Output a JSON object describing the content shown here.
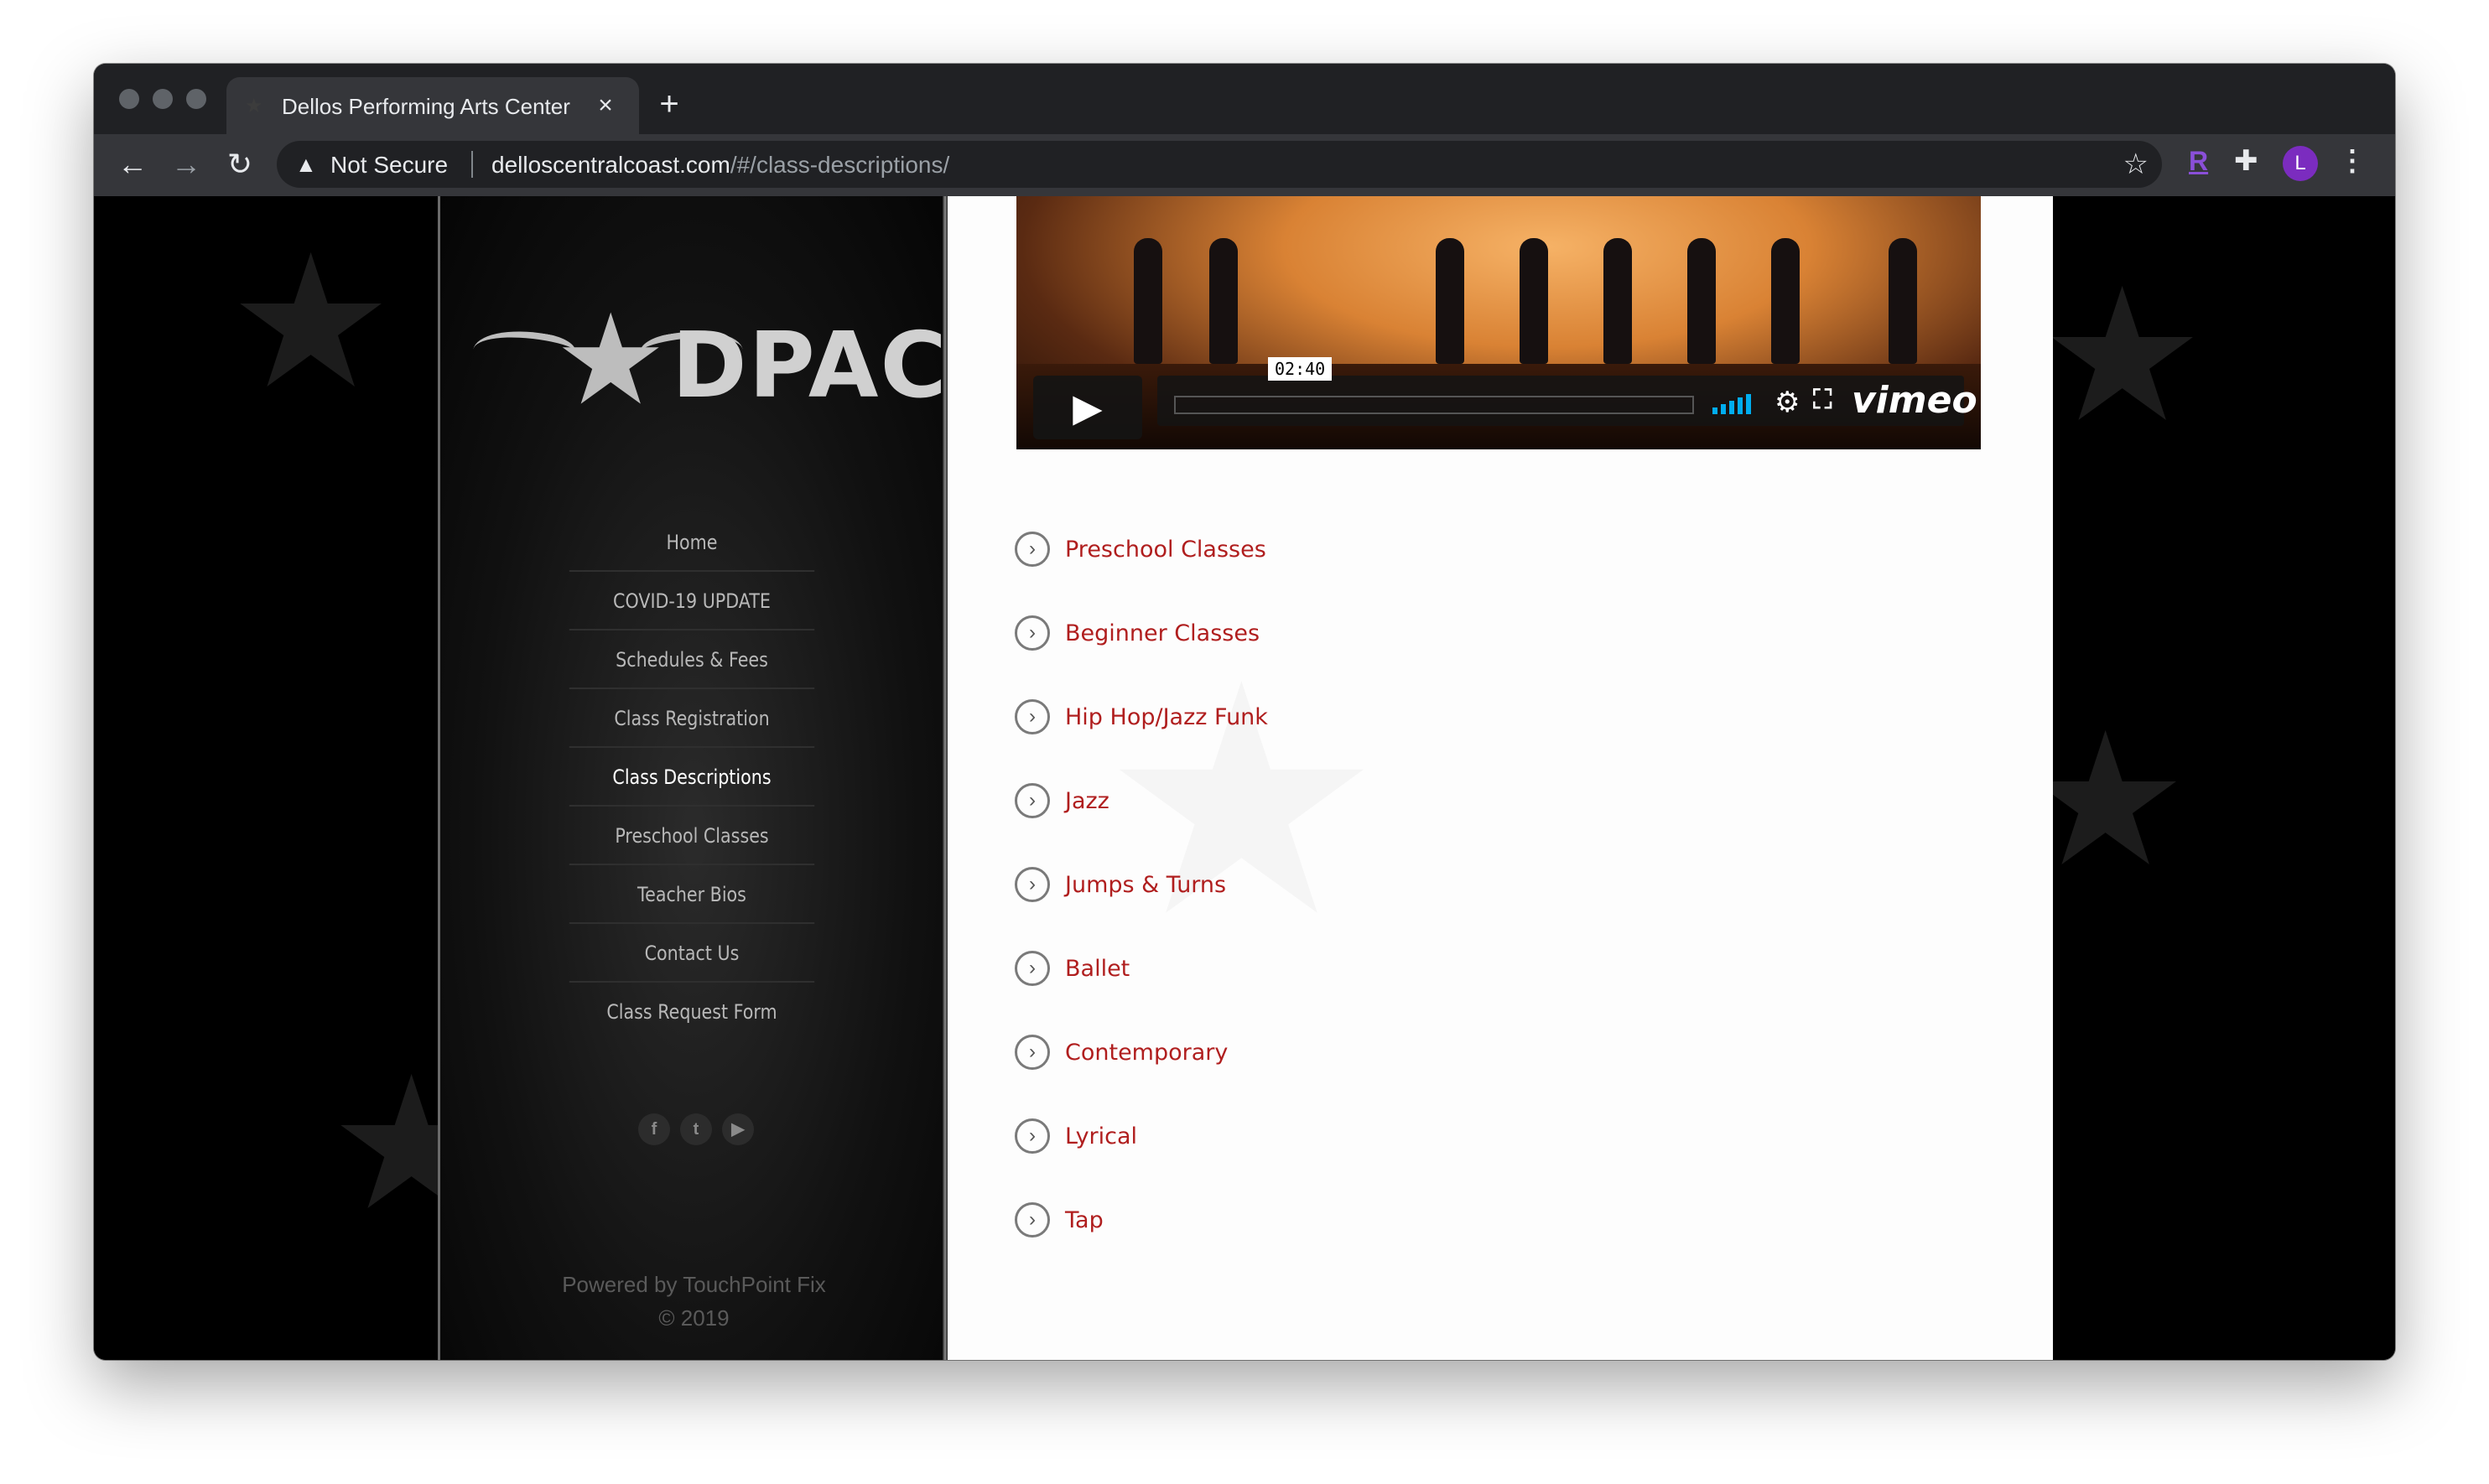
{
  "browser": {
    "tab_title": "Dellos Performing Arts Center",
    "new_tab": "+",
    "close_tab": "×",
    "security_label": "Not Secure",
    "url_host": "delloscentralcoast.com",
    "url_path": "/#/class-descriptions/",
    "avatar_initial": "L",
    "extension_letter": "R"
  },
  "sidebar": {
    "logo_text": "DPAC",
    "nav": [
      {
        "label": "Home",
        "active": false
      },
      {
        "label": "COVID-19 UPDATE",
        "active": false
      },
      {
        "label": "Schedules & Fees",
        "active": false
      },
      {
        "label": "Class Registration",
        "active": false
      },
      {
        "label": "Class Descriptions",
        "active": true
      },
      {
        "label": "Preschool Classes",
        "active": false
      },
      {
        "label": "Teacher Bios",
        "active": false
      },
      {
        "label": "Contact Us",
        "active": false
      },
      {
        "label": "Class Request Form",
        "active": false
      }
    ],
    "social": [
      "facebook-icon",
      "twitter-icon",
      "youtube-icon"
    ],
    "powered_by": "Powered by TouchPoint Fix",
    "copyright": "© 2019"
  },
  "video": {
    "time": "02:40",
    "brand": "vimeo"
  },
  "classes": [
    "Preschool Classes",
    "Beginner Classes",
    "Hip Hop/Jazz Funk",
    "Jazz",
    "Jumps & Turns",
    "Ballet",
    "Contemporary",
    "Lyrical",
    "Tap"
  ],
  "colors": {
    "link_red": "#b01e1e",
    "chrome_dark": "#202124",
    "vimeo_blue": "#00adef"
  }
}
